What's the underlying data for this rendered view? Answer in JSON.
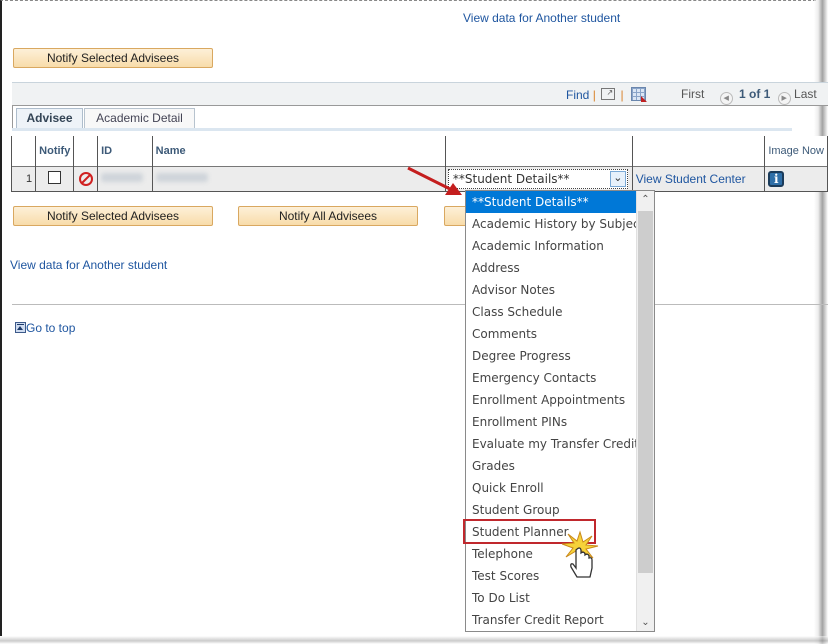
{
  "top_link": "View data for Another student",
  "buttons": {
    "notify_selected_top": "Notify Selected Advisees",
    "notify_selected_bottom": "Notify Selected Advisees",
    "notify_all": "Notify All Advisees"
  },
  "grid_toolbar": {
    "find": "Find",
    "separator": "|",
    "first": "First",
    "page_info": "1 of 1",
    "last": "Last"
  },
  "tabs": [
    {
      "label": "Advisee",
      "active": true
    },
    {
      "label": "Academic Detail",
      "active": false
    }
  ],
  "table": {
    "headers": [
      "",
      "Notify",
      "",
      "ID",
      "Name",
      "",
      "",
      "Image Now"
    ],
    "rows": [
      {
        "row_number": "1",
        "notify_checked": false,
        "id": "[redacted]",
        "name": "[redacted]",
        "select_value": "**Student Details**",
        "link": "View Student Center"
      }
    ]
  },
  "dropdown": {
    "selected": "**Student Details**",
    "options": [
      "**Student Details**",
      "Academic History by Subject",
      "Academic Information",
      "Address",
      "Advisor Notes",
      "Class Schedule",
      "Comments",
      "Degree Progress",
      "Emergency Contacts",
      "Enrollment Appointments",
      "Enrollment PINs",
      "Evaluate my Transfer Credit",
      "Grades",
      "Quick Enroll",
      "Student Group",
      "Student Planner",
      "Telephone",
      "Test Scores",
      "To Do List",
      "Transfer Credit Report"
    ],
    "highlighted_option": "Student Planner"
  },
  "bottom_link": "View data for Another student",
  "go_to_top": "Go to top",
  "colors": {
    "link": "#1f56a0",
    "button_bg": "#f8dcaa",
    "selected_option": "#0078d7",
    "callout": "#c0282d"
  }
}
